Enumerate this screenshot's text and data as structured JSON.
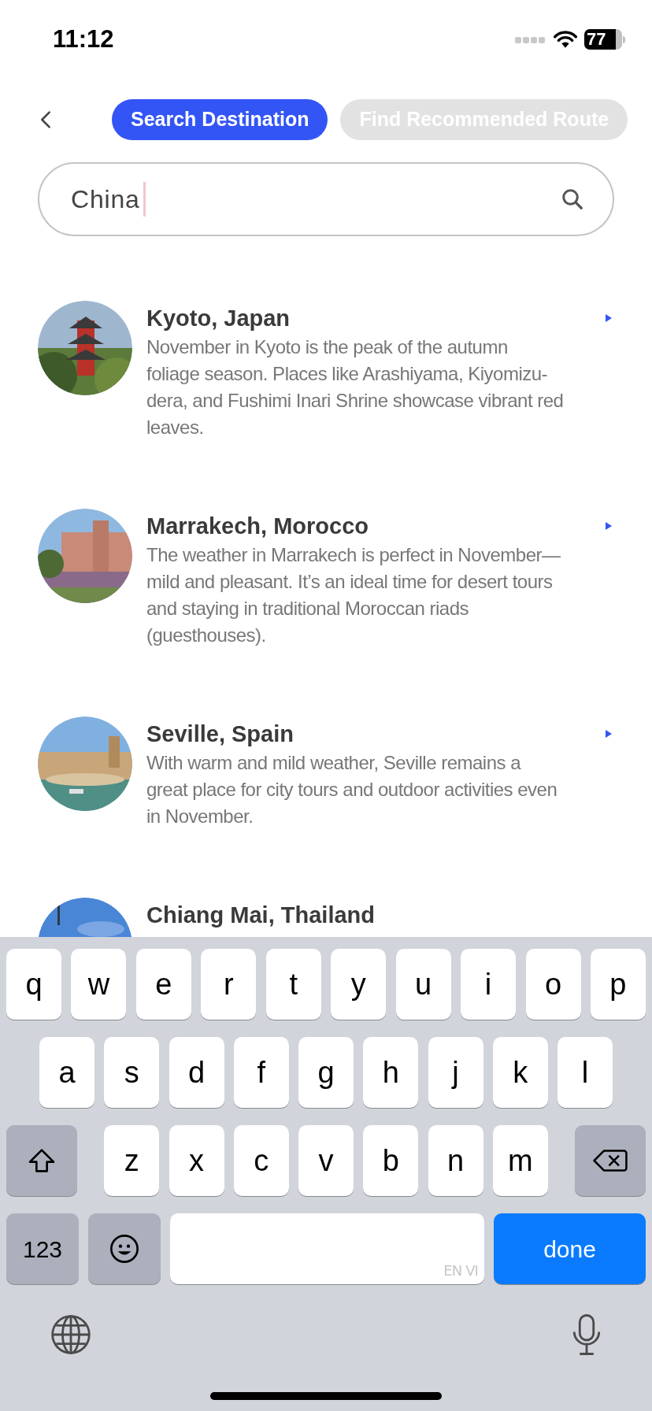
{
  "status_bar": {
    "time": "11:12",
    "battery": "77"
  },
  "tabs": [
    {
      "label": "Search Destination",
      "selected": true
    },
    {
      "label": "Find Recommended Route",
      "selected": false
    }
  ],
  "search": {
    "value": "China"
  },
  "destinations": [
    {
      "title": "Kyoto, Japan",
      "description": "November in Kyoto is the peak of the autumn foliage season. Places like Arashiyama, Kiyomizu-dera, and Fushimi Inari Shrine showcase vibrant red leaves."
    },
    {
      "title": "Marrakech, Morocco",
      "description": "The weather in Marrakech is perfect in November—mild and pleasant. It’s an ideal time for desert tours and staying in traditional Moroccan riads (guesthouses)."
    },
    {
      "title": "Seville, Spain",
      "description": "With warm and mild weather, Seville remains a great place for city tours and outdoor activities even in November."
    },
    {
      "title": "Chiang Mai, Thailand"
    }
  ],
  "keyboard": {
    "row_1": [
      "q",
      "w",
      "e",
      "r",
      "t",
      "y",
      "u",
      "i",
      "o",
      "p"
    ],
    "row_2": [
      "a",
      "s",
      "d",
      "f",
      "g",
      "h",
      "j",
      "k",
      "l"
    ],
    "row_3": [
      "z",
      "x",
      "c",
      "v",
      "b",
      "n",
      "m"
    ],
    "mode_key": "123",
    "space_label": "EN VI",
    "return_key": "done"
  }
}
